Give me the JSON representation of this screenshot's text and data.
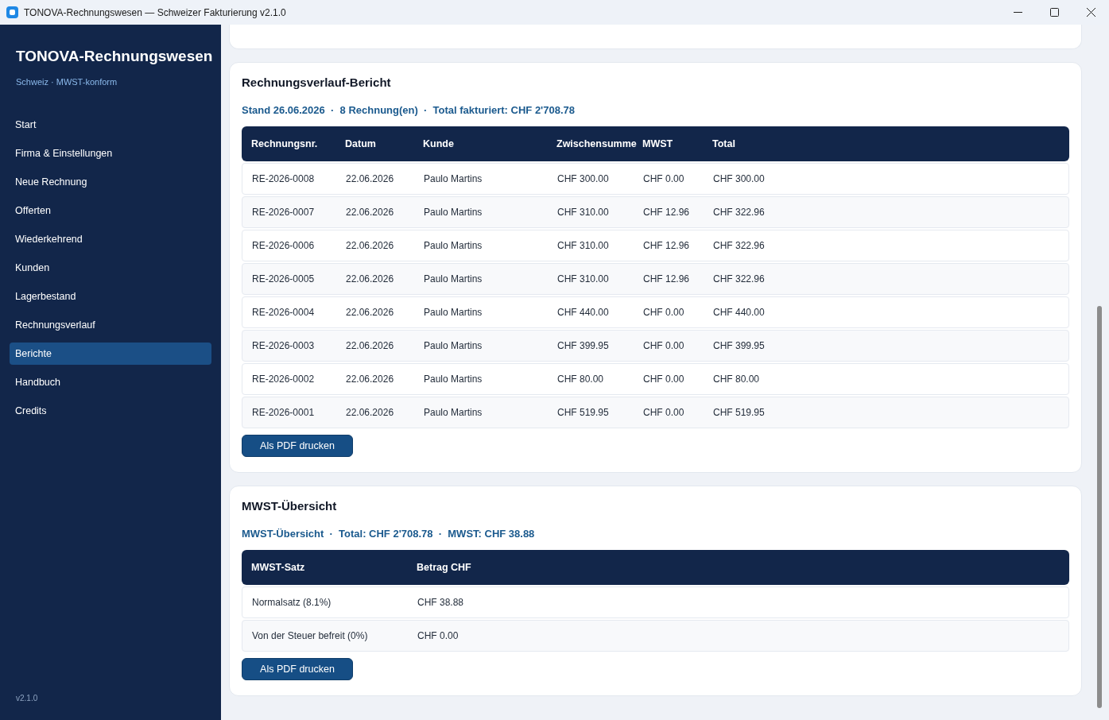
{
  "window": {
    "title": "TONOVA-Rechnungswesen — Schweizer Fakturierung v2.1.0"
  },
  "sidebar": {
    "title": "TONOVA-Rechnungswesen",
    "subtitle": "Schweiz · MWST-konform",
    "items": [
      {
        "label": "Start",
        "selected": false
      },
      {
        "label": "Firma & Einstellungen",
        "selected": false
      },
      {
        "label": "Neue Rechnung",
        "selected": false
      },
      {
        "label": "Offerten",
        "selected": false
      },
      {
        "label": "Wiederkehrend",
        "selected": false
      },
      {
        "label": "Kunden",
        "selected": false
      },
      {
        "label": "Lagerbestand",
        "selected": false
      },
      {
        "label": "Rechnungsverlauf",
        "selected": false
      },
      {
        "label": "Berichte",
        "selected": true
      },
      {
        "label": "Handbuch",
        "selected": false
      },
      {
        "label": "Credits",
        "selected": false
      }
    ],
    "version": "v2.1.0"
  },
  "sections": [
    {
      "title": "Rechnungsverlauf-Bericht",
      "summary": "Stand 26.06.2026  ·  8 Rechnung(en)  ·  Total fakturiert: CHF 2'708.78",
      "columns": [
        "Rechnungsnr.",
        "Datum",
        "Kunde",
        "Zwischensumme",
        "MWST",
        "Total"
      ],
      "rows": [
        [
          "RE-2026-0008",
          "22.06.2026",
          "Paulo Martins",
          "CHF 300.00",
          "CHF 0.00",
          "CHF 300.00"
        ],
        [
          "RE-2026-0007",
          "22.06.2026",
          "Paulo Martins",
          "CHF 310.00",
          "CHF 12.96",
          "CHF 322.96"
        ],
        [
          "RE-2026-0006",
          "22.06.2026",
          "Paulo Martins",
          "CHF 310.00",
          "CHF 12.96",
          "CHF 322.96"
        ],
        [
          "RE-2026-0005",
          "22.06.2026",
          "Paulo Martins",
          "CHF 310.00",
          "CHF 12.96",
          "CHF 322.96"
        ],
        [
          "RE-2026-0004",
          "22.06.2026",
          "Paulo Martins",
          "CHF 440.00",
          "CHF 0.00",
          "CHF 440.00"
        ],
        [
          "RE-2026-0003",
          "22.06.2026",
          "Paulo Martins",
          "CHF 399.95",
          "CHF 0.00",
          "CHF 399.95"
        ],
        [
          "RE-2026-0002",
          "22.06.2026",
          "Paulo Martins",
          "CHF 80.00",
          "CHF 0.00",
          "CHF 80.00"
        ],
        [
          "RE-2026-0001",
          "22.06.2026",
          "Paulo Martins",
          "CHF 519.95",
          "CHF 0.00",
          "CHF 519.95"
        ]
      ],
      "button": "Als PDF drucken"
    },
    {
      "title": "MWST-Übersicht",
      "summary": "MWST-Übersicht  ·  Total: CHF 2'708.78  ·  MWST: CHF 38.88",
      "columns": [
        "MWST-Satz",
        "Betrag CHF"
      ],
      "rows": [
        [
          "Normalsatz (8.1%)",
          "CHF 38.88"
        ],
        [
          "Von der Steuer befreit (0%)",
          "CHF 0.00"
        ]
      ],
      "button": "Als PDF drucken"
    }
  ]
}
